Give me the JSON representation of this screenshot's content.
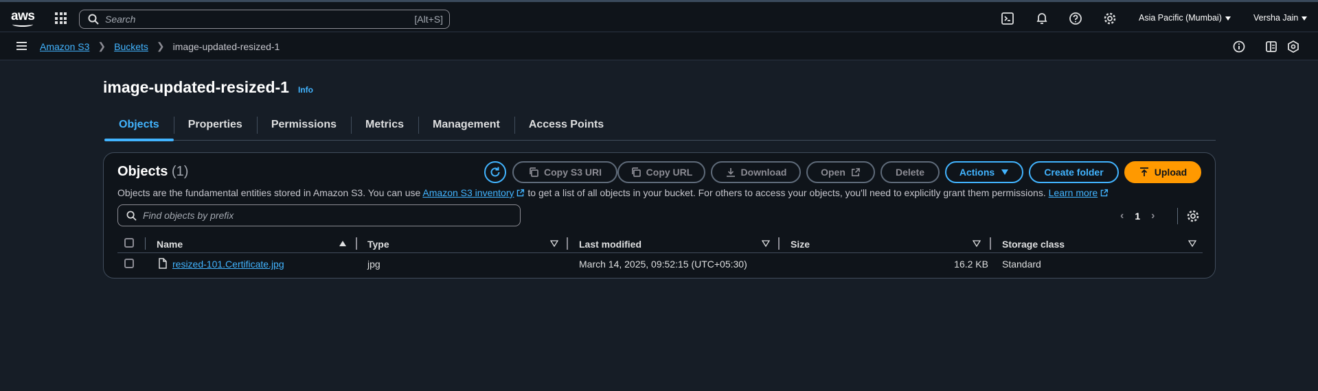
{
  "topbar": {
    "logo_text": "aws",
    "search_placeholder": "Search",
    "search_shortcut": "[Alt+S]",
    "region": "Asia Pacific (Mumbai)",
    "user": "Versha Jain"
  },
  "breadcrumb": {
    "items": [
      "Amazon S3",
      "Buckets"
    ],
    "current": "image-updated-resized-1"
  },
  "page": {
    "title": "image-updated-resized-1",
    "info_label": "Info"
  },
  "tabs": [
    "Objects",
    "Properties",
    "Permissions",
    "Metrics",
    "Management",
    "Access Points"
  ],
  "objects_panel": {
    "heading": "Objects",
    "count": "(1)",
    "desc_before": "Objects are the fundamental entities stored in Amazon S3. You can use ",
    "desc_link": "Amazon S3 inventory",
    "desc_after": " to get a list of all objects in your bucket. For others to access your objects, you'll need to explicitly grant them permissions.",
    "learn_more": "Learn more",
    "buttons": {
      "copy_s3_uri": "Copy S3 URI",
      "copy_url": "Copy URL",
      "download": "Download",
      "open": "Open",
      "delete": "Delete",
      "actions": "Actions",
      "create_folder": "Create folder",
      "upload": "Upload"
    },
    "filter_placeholder": "Find objects by prefix",
    "page_number": "1",
    "columns": [
      "Name",
      "Type",
      "Last modified",
      "Size",
      "Storage class"
    ],
    "rows": [
      {
        "name": "resized-101.Certificate.jpg",
        "type": "jpg",
        "last_modified": "March 14, 2025, 09:52:15 (UTC+05:30)",
        "size": "16.2 KB",
        "storage_class": "Standard"
      }
    ]
  },
  "colors": {
    "accent": "#42b4ff",
    "upload": "#ff9900",
    "background": "#161d26"
  }
}
